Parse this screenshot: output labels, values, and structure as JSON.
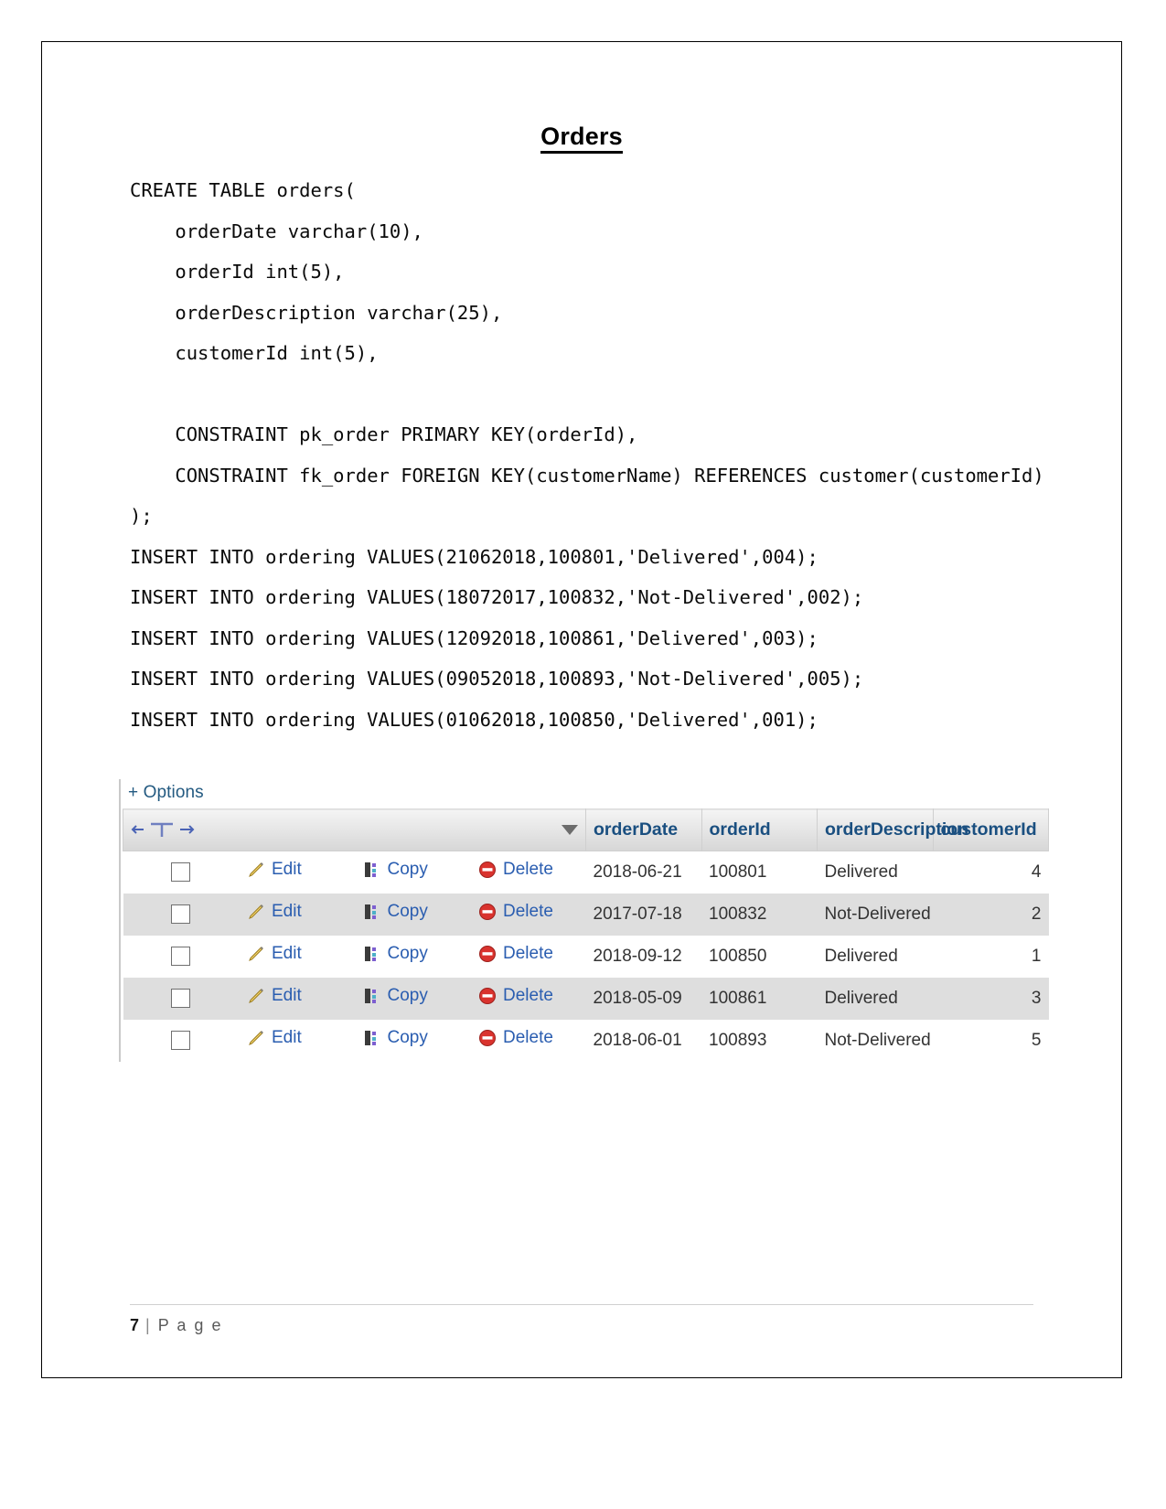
{
  "document": {
    "title": "Orders",
    "footer": {
      "page_number": "7",
      "separator": "|",
      "page_word": "P a g e"
    }
  },
  "sql": {
    "lines": [
      "CREATE TABLE orders(",
      "    orderDate varchar(10),",
      "    orderId int(5),",
      "    orderDescription varchar(25),",
      "    customerId int(5),",
      "",
      "    CONSTRAINT pk_order PRIMARY KEY(orderId),",
      "    CONSTRAINT fk_order FOREIGN KEY(customerName) REFERENCES customer(customerId)",
      ");",
      "INSERT INTO ordering VALUES(21062018,100801,'Delivered',004);",
      "INSERT INTO ordering VALUES(18072017,100832,'Not-Delivered',002);",
      "INSERT INTO ordering VALUES(12092018,100861,'Delivered',003);",
      "INSERT INTO ordering VALUES(09052018,100893,'Not-Delivered',005);",
      "INSERT INTO ordering VALUES(01062018,100850,'Delivered',001);"
    ]
  },
  "result_panel": {
    "options_label": "+ Options",
    "columns": {
      "order_date": "orderDate",
      "order_id": "orderId",
      "order_description": "orderDescription",
      "customer_id": "customerId"
    },
    "actions": {
      "edit": "Edit",
      "copy": "Copy",
      "delete": "Delete"
    },
    "rows": [
      {
        "orderDate": "2018-06-21",
        "orderId": "100801",
        "orderDescription": "Delivered",
        "customerId": "4"
      },
      {
        "orderDate": "2017-07-18",
        "orderId": "100832",
        "orderDescription": "Not-Delivered",
        "customerId": "2"
      },
      {
        "orderDate": "2018-09-12",
        "orderId": "100850",
        "orderDescription": "Delivered",
        "customerId": "1"
      },
      {
        "orderDate": "2018-05-09",
        "orderId": "100861",
        "orderDescription": "Delivered",
        "customerId": "3"
      },
      {
        "orderDate": "2018-06-01",
        "orderId": "100893",
        "orderDescription": "Not-Delivered",
        "customerId": "5"
      }
    ]
  },
  "colors": {
    "link": "#235a9f",
    "header_text": "#1a4f80",
    "row_alt": "#dedede"
  }
}
